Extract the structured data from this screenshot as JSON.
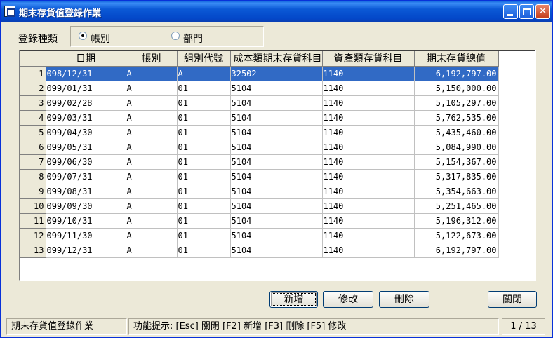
{
  "window": {
    "title": "期末存貨值登錄作業",
    "minimize": "_",
    "maximize": "□",
    "close": "✕"
  },
  "filter": {
    "label": "登錄種類",
    "options": [
      {
        "label": "帳別",
        "selected": true
      },
      {
        "label": "部門",
        "selected": false
      }
    ]
  },
  "grid": {
    "columns": [
      "",
      "日期",
      "帳別",
      "組別代號",
      "成本類期末存貨科目",
      "資產類存貨科目",
      "期末存貨總值"
    ],
    "rows": [
      {
        "no": "1",
        "date": "098/12/31",
        "book": "A",
        "group": "A",
        "cost_acct": "32502",
        "asset_acct": "1140",
        "total": "6,192,797.00"
      },
      {
        "no": "2",
        "date": "099/01/31",
        "book": "A",
        "group": "01",
        "cost_acct": "5104",
        "asset_acct": "1140",
        "total": "5,150,000.00"
      },
      {
        "no": "3",
        "date": "099/02/28",
        "book": "A",
        "group": "01",
        "cost_acct": "5104",
        "asset_acct": "1140",
        "total": "5,105,297.00"
      },
      {
        "no": "4",
        "date": "099/03/31",
        "book": "A",
        "group": "01",
        "cost_acct": "5104",
        "asset_acct": "1140",
        "total": "5,762,535.00"
      },
      {
        "no": "5",
        "date": "099/04/30",
        "book": "A",
        "group": "01",
        "cost_acct": "5104",
        "asset_acct": "1140",
        "total": "5,435,460.00"
      },
      {
        "no": "6",
        "date": "099/05/31",
        "book": "A",
        "group": "01",
        "cost_acct": "5104",
        "asset_acct": "1140",
        "total": "5,084,990.00"
      },
      {
        "no": "7",
        "date": "099/06/30",
        "book": "A",
        "group": "01",
        "cost_acct": "5104",
        "asset_acct": "1140",
        "total": "5,154,367.00"
      },
      {
        "no": "8",
        "date": "099/07/31",
        "book": "A",
        "group": "01",
        "cost_acct": "5104",
        "asset_acct": "1140",
        "total": "5,317,835.00"
      },
      {
        "no": "9",
        "date": "099/08/31",
        "book": "A",
        "group": "01",
        "cost_acct": "5104",
        "asset_acct": "1140",
        "total": "5,354,663.00"
      },
      {
        "no": "10",
        "date": "099/09/30",
        "book": "A",
        "group": "01",
        "cost_acct": "5104",
        "asset_acct": "1140",
        "total": "5,251,465.00"
      },
      {
        "no": "11",
        "date": "099/10/31",
        "book": "A",
        "group": "01",
        "cost_acct": "5104",
        "asset_acct": "1140",
        "total": "5,196,312.00"
      },
      {
        "no": "12",
        "date": "099/11/30",
        "book": "A",
        "group": "01",
        "cost_acct": "5104",
        "asset_acct": "1140",
        "total": "5,122,673.00"
      },
      {
        "no": "13",
        "date": "099/12/31",
        "book": "A",
        "group": "01",
        "cost_acct": "5104",
        "asset_acct": "1140",
        "total": "6,192,797.00"
      }
    ],
    "selected_row": 0
  },
  "buttons": {
    "add": "新增",
    "edit": "修改",
    "delete": "刪除",
    "close": "關閉"
  },
  "status": {
    "form_name": "期末存貨值登錄作業",
    "hint": "功能提示:  [Esc] 關閉  [F2] 新增  [F3] 刪除  [F5] 修改",
    "record_pos": "1 / 13"
  },
  "colors": {
    "selection": "#316ac5",
    "titlebar": "#0a5fd8"
  }
}
